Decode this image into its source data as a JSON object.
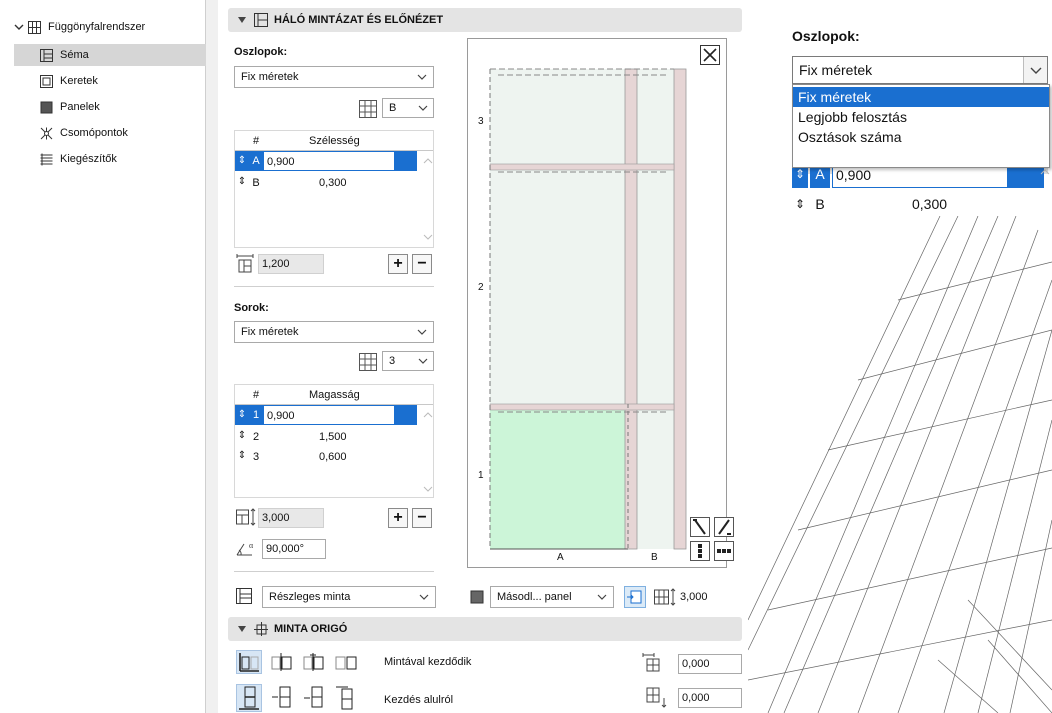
{
  "tree": {
    "root_label": "Függönyfalrendszer",
    "items": [
      {
        "label": "Séma",
        "selected": true,
        "icon": "schema-icon"
      },
      {
        "label": "Keretek",
        "selected": false,
        "icon": "frame-icon"
      },
      {
        "label": "Panelek",
        "selected": false,
        "icon": "panel-icon"
      },
      {
        "label": "Csomópontok",
        "selected": false,
        "icon": "junction-icon"
      },
      {
        "label": "Kiegészítők",
        "selected": false,
        "icon": "accessory-icon"
      }
    ]
  },
  "grid_section": {
    "title": "HÁLÓ MINTÁZAT ÉS ELŐNÉZET",
    "columns": {
      "label": "Oszlopok:",
      "mode": "Fix méretek",
      "pattern_count": "B",
      "table_header_hash": "#",
      "table_header_value": "Szélesség",
      "rows": [
        {
          "id": "A",
          "value": "0,900",
          "active": true
        },
        {
          "id": "B",
          "value": "0,300",
          "active": false
        }
      ],
      "total": "1,200",
      "add_label": "+",
      "remove_label": "−"
    },
    "rows_group": {
      "label": "Sorok:",
      "mode": "Fix méretek",
      "pattern_count": "3",
      "table_header_hash": "#",
      "table_header_value": "Magasság",
      "rows": [
        {
          "id": "1",
          "value": "0,900",
          "active": true
        },
        {
          "id": "2",
          "value": "1,500",
          "active": false
        },
        {
          "id": "3",
          "value": "0,600",
          "active": false
        }
      ],
      "total": "3,000",
      "add_label": "+",
      "remove_label": "−"
    },
    "angle": "90,000°",
    "pattern_mode": "Részleges minta",
    "secondary_panel": "Másodl... panel",
    "height_readout": "3,000",
    "preview": {
      "row_labels": [
        "3",
        "2",
        "1"
      ],
      "col_labels": [
        "A",
        "B"
      ]
    }
  },
  "origin_section": {
    "title": "MINTA ORIGÓ",
    "start_with_pattern_label": "Mintával kezdődik",
    "start_bottom_label": "Kezdés alulról",
    "offset_x": "0,000",
    "offset_y": "0,000"
  },
  "zoom": {
    "title": "Oszlopok:",
    "selected": "Fix méretek",
    "options": [
      "Fix méretek",
      "Legjobb felosztás",
      "Osztások száma"
    ],
    "highlighted_index": 0,
    "rows": [
      {
        "id": "A",
        "value": "0,900",
        "active": true
      },
      {
        "id": "B",
        "value": "0,300",
        "active": false
      }
    ]
  },
  "colors": {
    "accent": "#1a6fd0",
    "section_bg": "#e4e4e4",
    "preview_green": "#ccf5d8",
    "preview_pale": "#eef4f0",
    "mullion": "#e6d5d5"
  }
}
